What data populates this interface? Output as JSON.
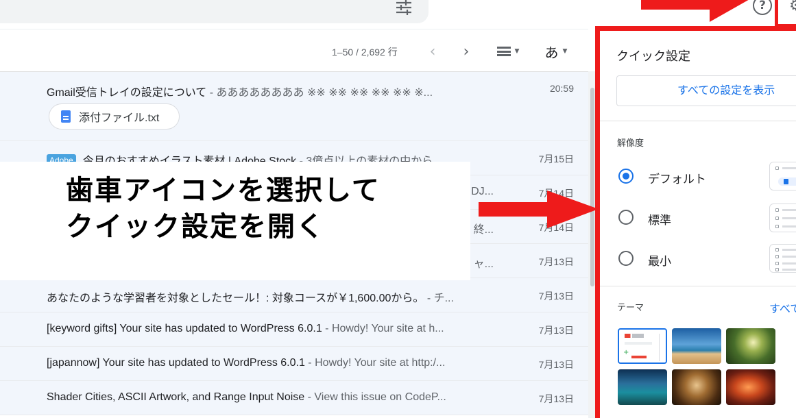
{
  "header": {
    "help_icon": "help-circle-icon",
    "gear_icon": "gear-icon",
    "tune_icon": "tune-icon",
    "help_glyph": "?",
    "gear_glyph": "⚙"
  },
  "toolbar": {
    "pager_text": "1–50 / 2,692 行",
    "prev_glyph": "‹",
    "next_glyph": "›",
    "ime_label": "あ",
    "caret": "▼"
  },
  "emails": [
    {
      "subject": "Gmail受信トレイの設定について",
      "snippet": " - ああああああああ ※※ ※※ ※※ ※※ ※※ ※...",
      "date": "20:59",
      "attachment": "添付ファイル.txt"
    },
    {
      "badge": "Adobe",
      "subject": "今月のおすすめイラスト素材 | Adobe Stock",
      "snippet": " - 3億点以上の素材の中から...",
      "date": "7月15日"
    },
    {
      "subject": "",
      "snippet": "DJ...",
      "date": "7月14日"
    },
    {
      "subject": "",
      "snippet": "終...",
      "date": "7月14日"
    },
    {
      "subject": "",
      "snippet": "ャ...",
      "date": "7月13日"
    },
    {
      "subject": "あなたのような学習者を対象としたセール！: 対象コースが￥1,600.00から。",
      "snippet": " - チ...",
      "date": "7月13日"
    },
    {
      "subject": "[keyword gifts] Your site has updated to WordPress 6.0.1",
      "snippet": " - Howdy! Your site at h...",
      "date": "7月13日"
    },
    {
      "subject": "[japannow] Your site has updated to WordPress 6.0.1",
      "snippet": " - Howdy! Your site at http:/...",
      "date": "7月13日"
    },
    {
      "subject": "Shader Cities, ASCII Artwork, and Range Input Noise",
      "snippet": " - View this issue on CodeP...",
      "date": "7月13日"
    }
  ],
  "caption": {
    "line1": "歯車アイコンを選択して",
    "line2": "クイック設定を開く"
  },
  "quick_settings": {
    "title": "クイック設定",
    "all_settings_button": "すべての設定を表示",
    "density_heading": "解像度",
    "density_options": [
      {
        "label": "デフォルト",
        "selected": true
      },
      {
        "label": "標準",
        "selected": false
      },
      {
        "label": "最小",
        "selected": false
      }
    ],
    "theme_heading": "テーマ",
    "theme_link": "すべて",
    "theme_default_logo": "Gmail"
  },
  "colors": {
    "annotation_red": "#ee1b1b",
    "accent_blue": "#1a73e8"
  }
}
